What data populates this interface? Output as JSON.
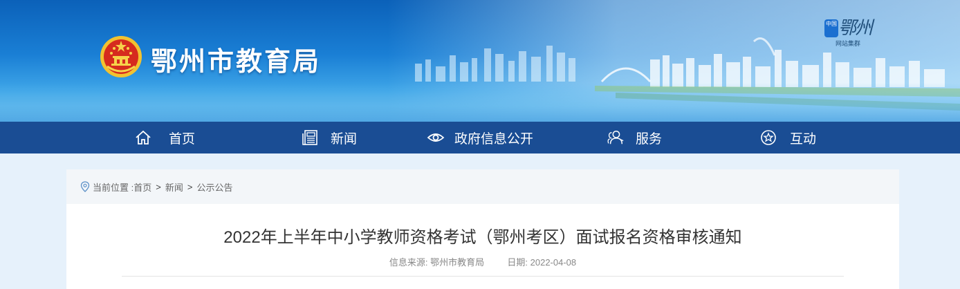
{
  "header": {
    "site_title": "鄂州市教育局",
    "corner_logo_main": "鄂州",
    "corner_logo_badge": "中国",
    "corner_logo_sub": "网站集群"
  },
  "nav": {
    "items": [
      {
        "label": "首页",
        "icon": "home-icon"
      },
      {
        "label": "新闻",
        "icon": "newspaper-icon"
      },
      {
        "label": "政府信息公开",
        "icon": "eye-icon"
      },
      {
        "label": "服务",
        "icon": "people-icon"
      },
      {
        "label": "互动",
        "icon": "star-icon"
      }
    ]
  },
  "breadcrumb": {
    "prefix": "当前位置 :",
    "items": [
      "首页",
      "新闻",
      "公示公告"
    ],
    "separator": ">"
  },
  "article": {
    "title": "2022年上半年中小学教师资格考试（鄂州考区）面试报名资格审核通知",
    "source_label": "信息来源:",
    "source_value": "鄂州市教育局",
    "date_label": "日期:",
    "date_value": "2022-04-08"
  },
  "colors": {
    "nav_bg": "#1a4d94",
    "banner_top": "#0b61b9",
    "page_bg": "#e6f1fb"
  }
}
